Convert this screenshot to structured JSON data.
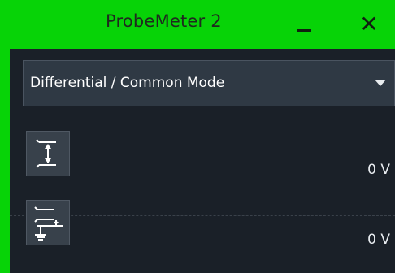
{
  "window": {
    "title": "ProbeMeter 2",
    "accent_color": "#07d307",
    "minimize_icon": "minimize-icon",
    "close_icon": "close-icon",
    "close_glyph": "✕"
  },
  "mode_select": {
    "value": "Differential / Common Mode"
  },
  "measurements": [
    {
      "icon": "differential-mode-icon",
      "value": "0 V"
    },
    {
      "icon": "common-mode-icon",
      "value": "0 V"
    }
  ]
}
